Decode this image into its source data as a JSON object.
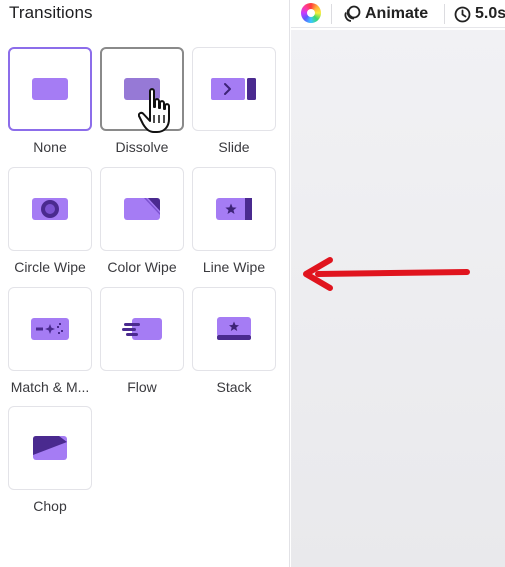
{
  "panel": {
    "title": "Transitions"
  },
  "tiles": [
    {
      "label": "None",
      "icon": "none-transition-icon",
      "state": "selected"
    },
    {
      "label": "Dissolve",
      "icon": "dissolve-transition-icon",
      "state": "hovered"
    },
    {
      "label": "Slide",
      "icon": "slide-transition-icon",
      "state": "normal"
    },
    {
      "label": "Circle Wipe",
      "icon": "circle-wipe-transition-icon",
      "state": "normal"
    },
    {
      "label": "Color Wipe",
      "icon": "color-wipe-transition-icon",
      "state": "normal"
    },
    {
      "label": "Line Wipe",
      "icon": "line-wipe-transition-icon",
      "state": "normal"
    },
    {
      "label": "Match & M...",
      "icon": "match-and-move-transition-icon",
      "state": "normal"
    },
    {
      "label": "Flow",
      "icon": "flow-transition-icon",
      "state": "normal"
    },
    {
      "label": "Stack",
      "icon": "stack-transition-icon",
      "state": "normal"
    },
    {
      "label": "Chop",
      "icon": "chop-transition-icon",
      "state": "normal"
    }
  ],
  "toolbar": {
    "animate_label": "Animate",
    "duration_label": "5.0s"
  },
  "colors": {
    "accent_purple": "#a57cf4",
    "dark_purple": "#4a2a8f",
    "selected_border": "#8c6dea",
    "annotation_red": "#e0141e"
  }
}
